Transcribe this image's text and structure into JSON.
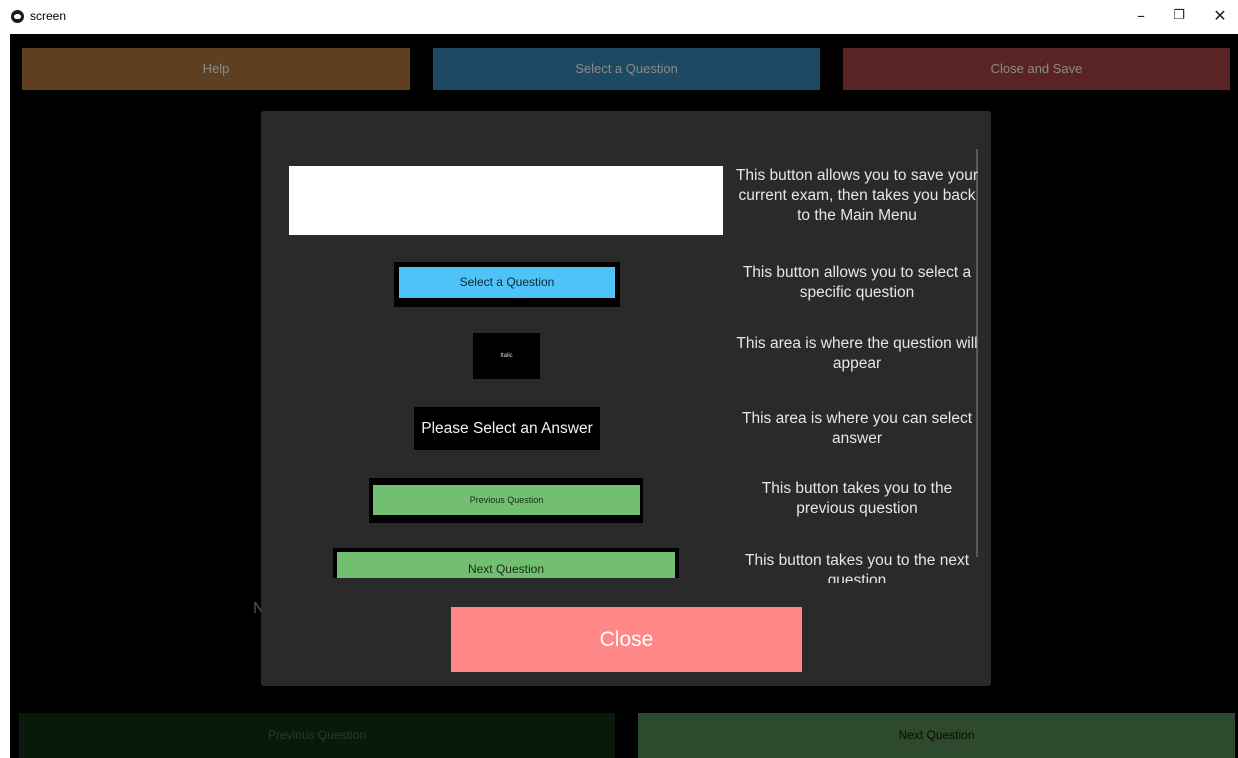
{
  "window": {
    "title": "screen",
    "minimize_glyph": "–",
    "maximize_glyph": "❐",
    "close_glyph": "✕"
  },
  "toolbar": {
    "help_label": "Help",
    "select_label": "Select a Question",
    "close_save_label": "Close and Save"
  },
  "background": {
    "hidden_text": "N"
  },
  "footer": {
    "previous_label": "Previous Question",
    "next_label": "Next Question"
  },
  "help_dialog": {
    "examples": {
      "select_label": "Select a Question",
      "question_label": "Italic",
      "answer_label": "Please Select an Answer",
      "previous_label": "Previous Question",
      "next_label": "Next Question"
    },
    "descriptions": [
      "This button allows you to save your current exam, then takes you back to the Main Menu",
      "This button allows you to select a specific question",
      "This area is where the question will appear",
      "This area is where you can select answer",
      "This button takes you to the previous question",
      "This button takes you to the next question"
    ],
    "close_label": "Close"
  },
  "colors": {
    "help": "#5e3f22",
    "select": "#1d4a62",
    "close_save": "#5a2424",
    "example_select": "#4fc3f7",
    "example_nav": "#73bf72",
    "dialog_close": "#ff8787",
    "dialog_bg": "#2a2a2a"
  }
}
